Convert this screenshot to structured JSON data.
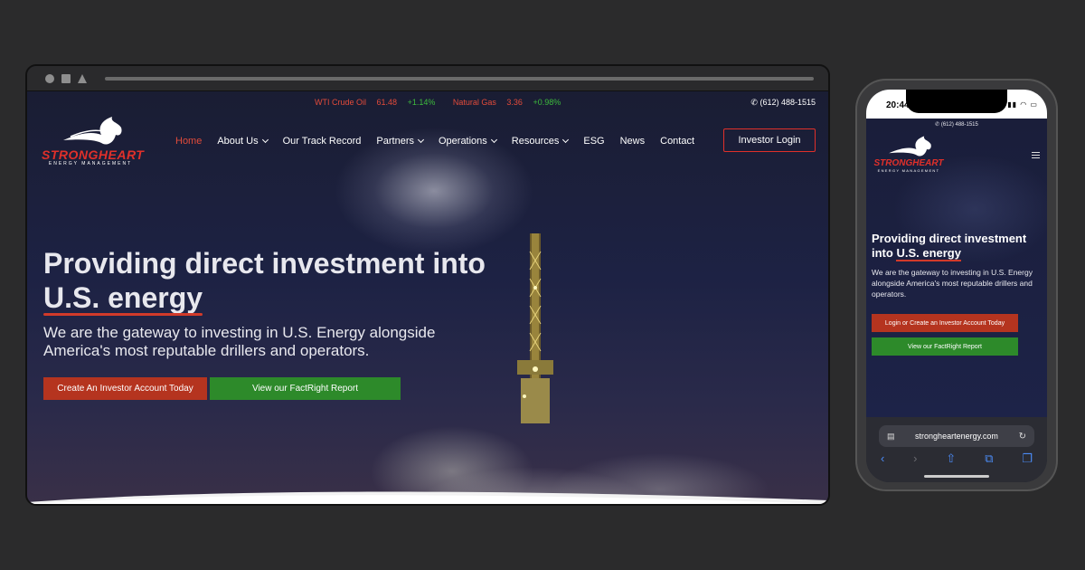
{
  "desktop": {
    "ticker": [
      {
        "label": "WTI Crude Oil",
        "price": "61.48",
        "change": "+1.14%"
      },
      {
        "label": "Natural Gas",
        "price": "3.36",
        "change": "+0.98%"
      }
    ],
    "phone": "(612) 488-1515",
    "logo": {
      "word": "STRONGHEART",
      "sub": "ENERGY MANAGEMENT"
    },
    "nav": [
      {
        "label": "Home",
        "dropdown": false,
        "active": true
      },
      {
        "label": "About Us",
        "dropdown": true
      },
      {
        "label": "Our Track Record",
        "dropdown": false
      },
      {
        "label": "Partners",
        "dropdown": true
      },
      {
        "label": "Operations",
        "dropdown": true
      },
      {
        "label": "Resources",
        "dropdown": true
      },
      {
        "label": "ESG",
        "dropdown": false
      },
      {
        "label": "News",
        "dropdown": false
      },
      {
        "label": "Contact",
        "dropdown": false
      }
    ],
    "login_label": "Investor Login",
    "hero": {
      "title_pre": "Providing direct investment into",
      "title_highlight": "U.S. energy",
      "subtitle": "We are the gateway to investing in U.S. Energy alongside America's most reputable drillers and operators.",
      "cta_primary": "Create An Investor Account Today",
      "cta_secondary": "View our FactRight Report"
    }
  },
  "mobile": {
    "time": "20:44",
    "phone": "(612) 488-1515",
    "logo": {
      "word": "STRONGHEART",
      "sub": "ENERGY MANAGEMENT"
    },
    "hero": {
      "title_pre": "Providing direct investment into",
      "title_highlight": "U.S. energy",
      "subtitle": "We are the gateway to investing in U.S. Energy alongside America's most reputable drillers and operators.",
      "cta_primary": "Login or Create an Investor Account Today",
      "cta_secondary": "View our FactRight Report"
    },
    "url": "strongheartenergy.com"
  },
  "icons": [
    "phone-icon",
    "chevron-down-icon",
    "menu-icon",
    "reload-icon",
    "back-icon",
    "forward-icon",
    "share-icon",
    "bookmarks-icon",
    "tabs-icon"
  ],
  "colors": {
    "accent_red": "#e0302a",
    "button_red": "#b5341f",
    "button_green": "#2d8a2a",
    "ticker_up": "#3dbb3d"
  }
}
